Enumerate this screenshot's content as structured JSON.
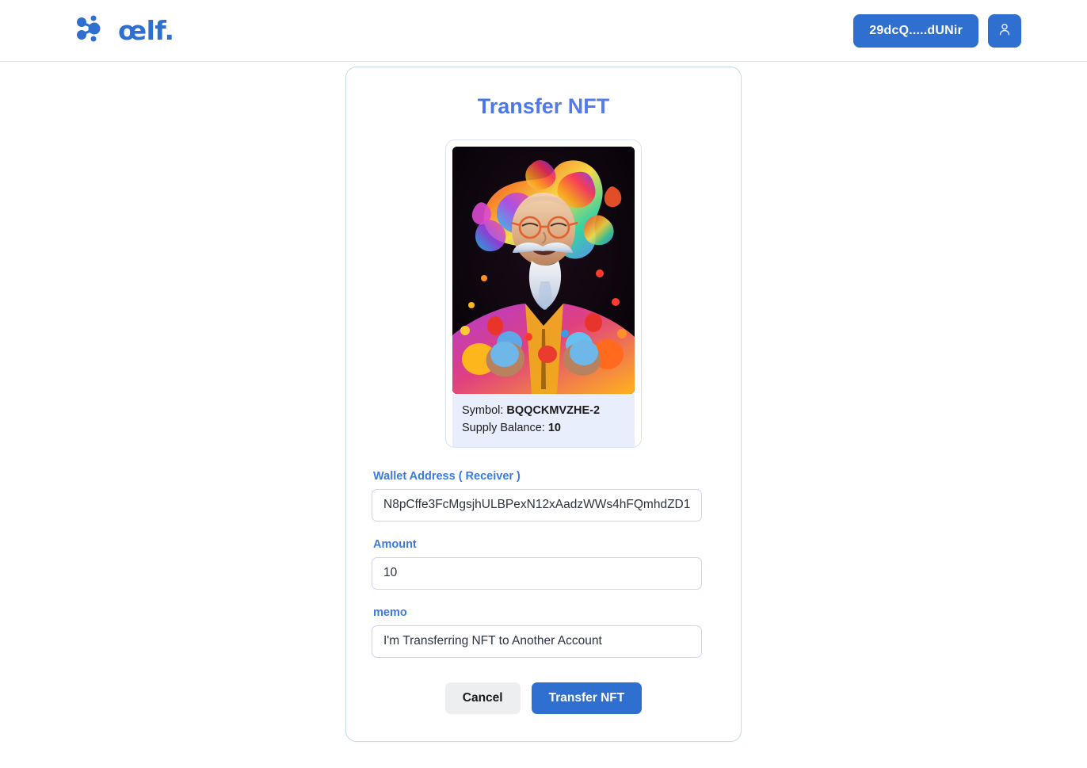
{
  "header": {
    "brand_word": "œlf.",
    "brand_icon": "aelf-network-nodes-logo",
    "wallet_label": "29dcQ.....dUNir",
    "avatar_icon": "user-icon"
  },
  "main": {
    "title": "Transfer NFT",
    "nft": {
      "image_alt": "colorful-rainbow-haired-old-man-nft-artwork",
      "symbol_label": "Symbol:",
      "symbol_value": "BQQCKMVZHE-2",
      "supply_label": "Supply Balance:",
      "supply_value": "10"
    },
    "form": {
      "wallet": {
        "label": "Wallet Address ( Receiver )",
        "value": "N8pCffe3FcMgsjhULBPexN12xAadzWWs4hFQmhdZD1",
        "placeholder": "Wallet Address ( Receiver )"
      },
      "amount": {
        "label": "Amount",
        "value": "10",
        "placeholder": "Amount"
      },
      "memo": {
        "label": "memo",
        "value": "I'm Transferring NFT to Another Account",
        "placeholder": "memo"
      }
    },
    "actions": {
      "cancel_label": "Cancel",
      "submit_label": "Transfer NFT"
    }
  },
  "colors": {
    "brand_blue": "#2f6fd0",
    "label_blue": "#3b7ae4",
    "card_border": "#c9d9f0",
    "meta_bg": "#e8eefb",
    "cancel_bg": "#eceef0"
  }
}
